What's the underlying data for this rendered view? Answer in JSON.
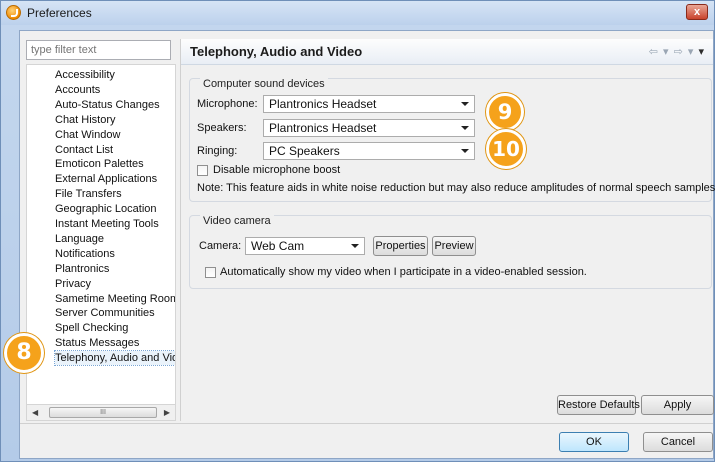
{
  "window": {
    "title": "Preferences",
    "close_label": "x"
  },
  "sidebar": {
    "filter_placeholder": "type filter text",
    "items": [
      "Accessibility",
      "Accounts",
      "Auto-Status Changes",
      "Chat History",
      "Chat Window",
      "Contact List",
      "Emoticon Palettes",
      "External Applications",
      "File Transfers",
      "Geographic Location",
      "Instant Meeting Tools",
      "Language",
      "Notifications",
      "Plantronics",
      "Privacy",
      "Sametime Meeting Rooms",
      "Server Communities",
      "Spell Checking",
      "Status Messages",
      "Telephony, Audio and Video"
    ],
    "selected_item": "Telephony, Audio and Video",
    "scroll_thumb": "III"
  },
  "page": {
    "title": "Telephony, Audio and Video",
    "nav": {
      "back": "⇦",
      "forward": "⇨",
      "menu": "▾"
    },
    "sound": {
      "group_title": "Computer sound devices",
      "microphone_label": "Microphone:",
      "microphone_value": "Plantronics Headset",
      "speakers_label": "Speakers:",
      "speakers_value": "Plantronics Headset",
      "ringing_label": "Ringing:",
      "ringing_value": "PC Speakers",
      "boost_label": "Disable microphone boost",
      "note": "Note: This feature aids in white noise reduction but may also reduce amplitudes of normal speech samples."
    },
    "video": {
      "group_title": "Video camera",
      "camera_label": "Camera:",
      "camera_value": "Web Cam",
      "properties_label": "Properties",
      "preview_label": "Preview",
      "auto_show_label": "Automatically show my video when I participate in a video-enabled session."
    }
  },
  "buttons": {
    "restore_defaults": "Restore Defaults",
    "apply": "Apply",
    "ok": "OK",
    "cancel": "Cancel"
  },
  "callouts": {
    "sidebar": "8",
    "speakers": "9",
    "ringing": "10"
  },
  "colors": {
    "callout": "#f5a21b",
    "selection": "#3399ff",
    "title_bar": "#c4d7ee"
  }
}
